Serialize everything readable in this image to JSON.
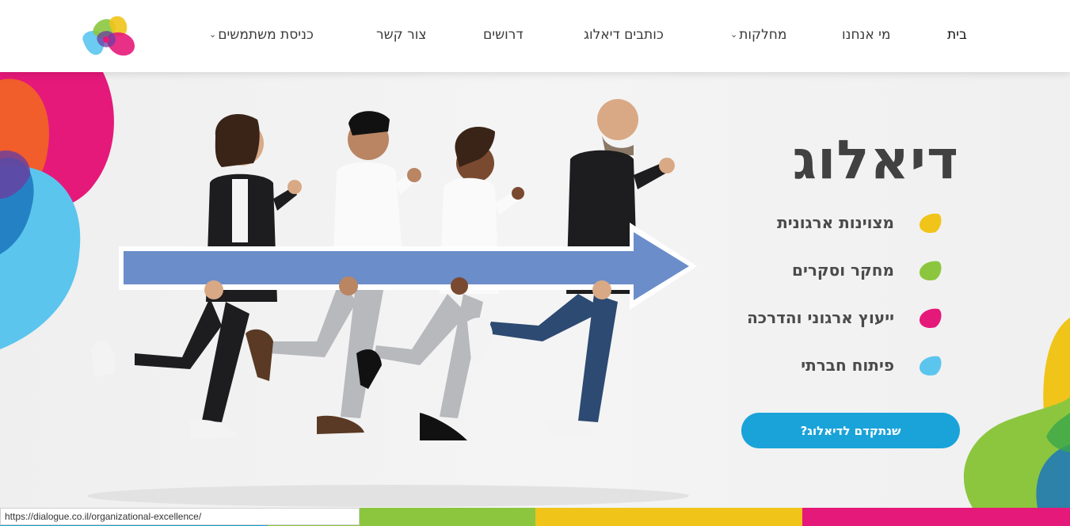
{
  "header": {
    "nav": [
      {
        "label": "בית",
        "active": true,
        "dropdown": false
      },
      {
        "label": "מי אנחנו",
        "active": false,
        "dropdown": false
      },
      {
        "label": "מחלקות",
        "active": false,
        "dropdown": true
      },
      {
        "label": "כותבים דיאלוג",
        "active": false,
        "dropdown": false
      },
      {
        "label": "דרושים",
        "active": false,
        "dropdown": false
      },
      {
        "label": "צור קשר",
        "active": false,
        "dropdown": false
      },
      {
        "label": "כניסת משתמשים",
        "active": false,
        "dropdown": true
      }
    ],
    "chevron_glyph": "⌄"
  },
  "hero": {
    "headline": "דיאלוג",
    "features": [
      {
        "label": "מצוינות ארגונית",
        "color": "#f0c419"
      },
      {
        "label": "מחקר וסקרים",
        "color": "#8cc63f"
      },
      {
        "label": "ייעוץ ארגוני והדרכה",
        "color": "#e5197a"
      },
      {
        "label": "פיתוח חברתי",
        "color": "#5bc5ee"
      }
    ],
    "cta_label": "שנתקדם לדיאלוג?"
  },
  "footer_strip": {
    "colors": [
      "#1aa3d9",
      "#8cc63f",
      "#f0c419",
      "#e5197a"
    ]
  },
  "status_bar": {
    "url": "https://dialogue.co.il/organizational-excellence/"
  }
}
